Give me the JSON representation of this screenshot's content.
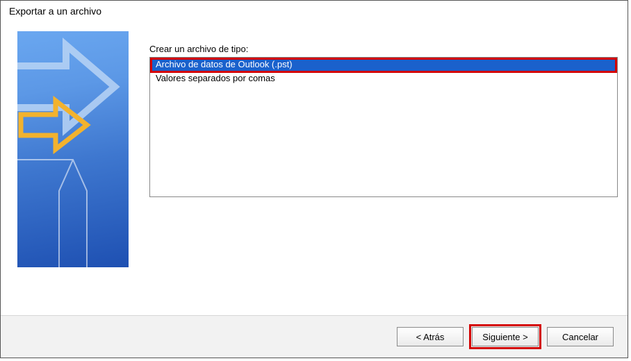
{
  "dialog": {
    "title": "Exportar a un archivo"
  },
  "content": {
    "prompt": "Crear un archivo de tipo:",
    "options": [
      "Archivo de datos de Outlook (.pst)",
      "Valores separados por comas"
    ]
  },
  "buttons": {
    "back": "<  Atrás",
    "next": "Siguiente  >",
    "cancel": "Cancelar"
  }
}
